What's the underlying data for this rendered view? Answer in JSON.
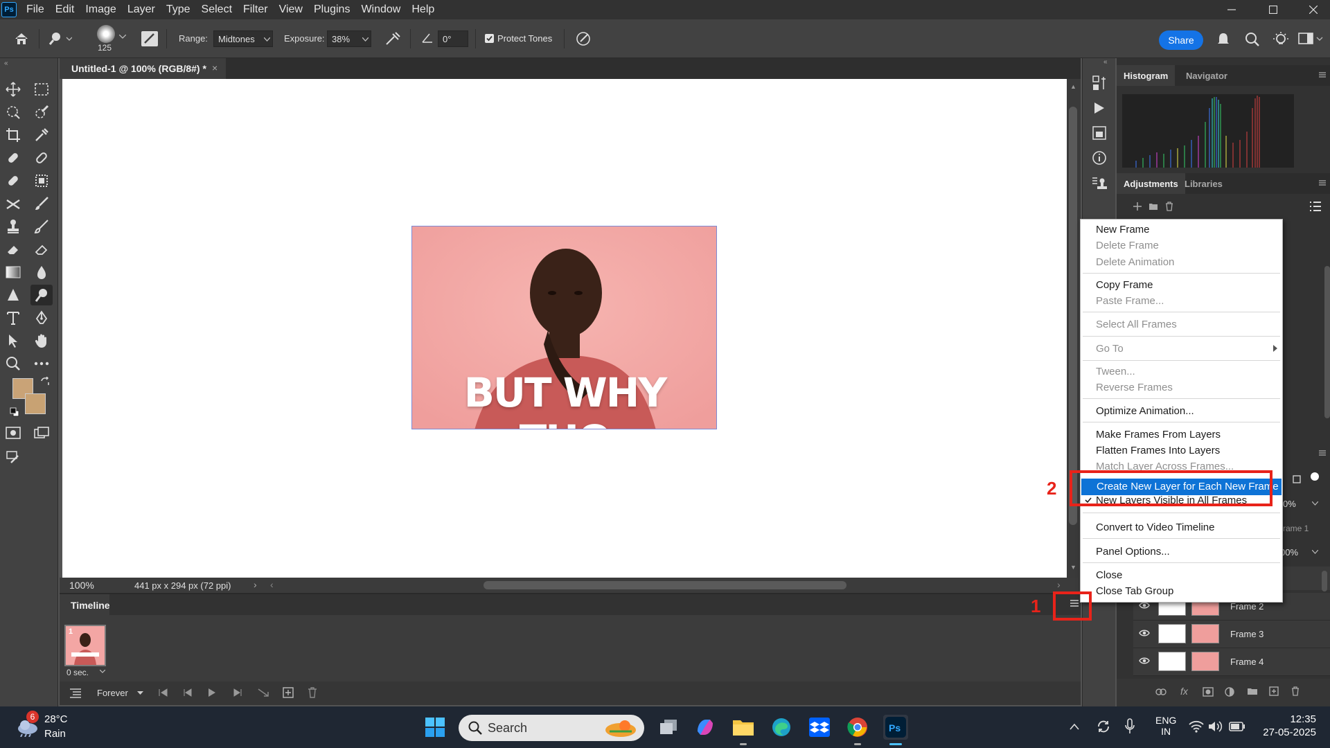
{
  "app": {
    "logo": "Ps",
    "menu": [
      "File",
      "Edit",
      "Image",
      "Layer",
      "Type",
      "Select",
      "Filter",
      "View",
      "Plugins",
      "Window",
      "Help"
    ]
  },
  "options_bar": {
    "brush_size": "125",
    "range_label": "Range:",
    "range_value": "Midtones",
    "exposure_label": "Exposure:",
    "exposure_value": "38%",
    "angle_value": "0°",
    "protect_tones_label": "Protect Tones",
    "protect_tones_checked": true,
    "share_label": "Share"
  },
  "document": {
    "tab_title": "Untitled-1 @ 100% (RGB/8#) *",
    "zoom": "100%",
    "info": "441 px x 294 px (72 ppi)",
    "image_caption": "BUT WHY THO"
  },
  "timeline": {
    "tab_label": "Timeline",
    "frame_number": "1",
    "frame_delay": "0 sec.",
    "loop_option": "Forever"
  },
  "panels": {
    "top_tabs": [
      "Histogram",
      "Navigator"
    ],
    "adjust_tabs": [
      "Adjustments",
      "Libraries"
    ],
    "opacity_partial": "0%",
    "fill_partial": "00%",
    "frame_partial": "rame 1",
    "layers": [
      {
        "name": "Frame 2"
      },
      {
        "name": "Frame 3"
      },
      {
        "name": "Frame 4"
      }
    ]
  },
  "context_menu": {
    "items": [
      {
        "label": "New Frame",
        "enabled": true
      },
      {
        "label": "Delete Frame",
        "enabled": false
      },
      {
        "label": "Delete Animation",
        "enabled": false
      },
      {
        "label": "Copy Frame",
        "enabled": true
      },
      {
        "label": "Paste Frame...",
        "enabled": false
      },
      {
        "label": "Select All Frames",
        "enabled": false
      },
      {
        "label": "Go To",
        "enabled": false
      },
      {
        "label": "Tween...",
        "enabled": false
      },
      {
        "label": "Reverse Frames",
        "enabled": false
      },
      {
        "label": "Optimize Animation...",
        "enabled": true
      },
      {
        "label": "Make Frames From Layers",
        "enabled": true
      },
      {
        "label": "Flatten Frames Into Layers",
        "enabled": true
      },
      {
        "label": "Match Layer Across Frames...",
        "enabled": false
      },
      {
        "label": "Create New Layer for Each New Frame",
        "enabled": true,
        "highlighted": true
      },
      {
        "label": "New Layers Visible in All Frames",
        "enabled": true,
        "checked": true
      },
      {
        "label": "Convert to Video Timeline",
        "enabled": true
      },
      {
        "label": "Panel Options...",
        "enabled": true
      },
      {
        "label": "Close",
        "enabled": true
      },
      {
        "label": "Close Tab Group",
        "enabled": true
      }
    ]
  },
  "annotations": {
    "step1": "1",
    "step2": "2",
    "color": "#e8231a"
  },
  "taskbar": {
    "weather_badge": "6",
    "weather_temp": "28°C",
    "weather_desc": "Rain",
    "search_placeholder": "Search",
    "lang_top": "ENG",
    "lang_bottom": "IN",
    "time": "12:35",
    "date": "27-05-2025"
  },
  "colors": {
    "accent": "#1473e6",
    "menu_highlight": "#0e73d6",
    "foreground_swatch": "#c9a377",
    "background_swatch": "#c8a273"
  }
}
